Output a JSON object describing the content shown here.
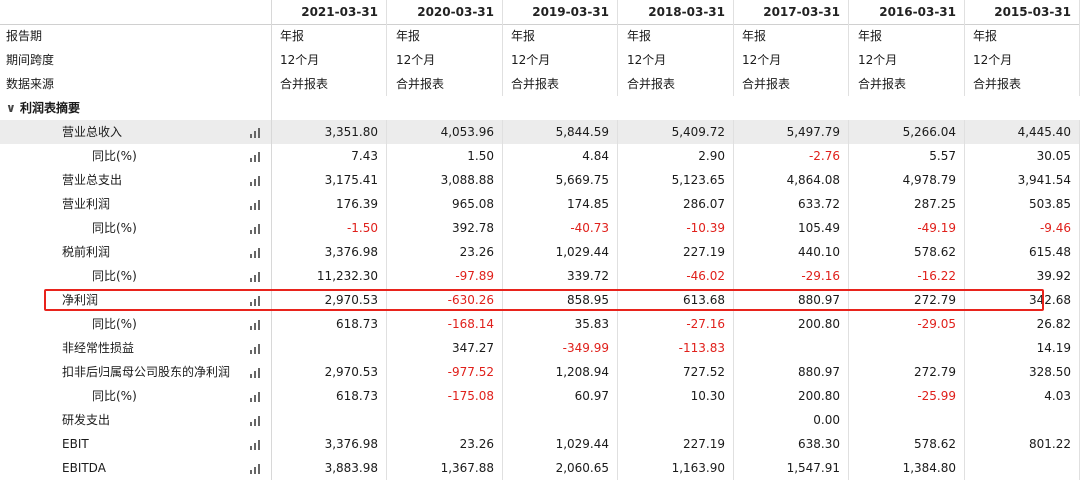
{
  "columns": [
    "2021-03-31",
    "2020-03-31",
    "2019-03-31",
    "2018-03-31",
    "2017-03-31",
    "2016-03-31",
    "2015-03-31"
  ],
  "meta_rows": [
    {
      "label": "报告期",
      "values": [
        "年报",
        "年报",
        "年报",
        "年报",
        "年报",
        "年报",
        "年报"
      ]
    },
    {
      "label": "期间跨度",
      "values": [
        "12个月",
        "12个月",
        "12个月",
        "12个月",
        "12个月",
        "12个月",
        "12个月"
      ]
    },
    {
      "label": "数据来源",
      "values": [
        "合并报表",
        "合并报表",
        "合并报表",
        "合并报表",
        "合并报表",
        "合并报表",
        "合并报表"
      ]
    }
  ],
  "section": {
    "label": "利润表摘要"
  },
  "rows": [
    {
      "label": "营业总收入",
      "indent": 1,
      "values": [
        "3,351.80",
        "4,053.96",
        "5,844.59",
        "5,409.72",
        "5,497.79",
        "5,266.04",
        "4,445.40"
      ]
    },
    {
      "label": "同比(%)",
      "indent": 2,
      "values": [
        "7.43",
        "1.50",
        "4.84",
        "2.90",
        "-2.76",
        "5.57",
        "30.05"
      ]
    },
    {
      "label": "营业总支出",
      "indent": 1,
      "values": [
        "3,175.41",
        "3,088.88",
        "5,669.75",
        "5,123.65",
        "4,864.08",
        "4,978.79",
        "3,941.54"
      ]
    },
    {
      "label": "营业利润",
      "indent": 1,
      "values": [
        "176.39",
        "965.08",
        "174.85",
        "286.07",
        "633.72",
        "287.25",
        "503.85"
      ]
    },
    {
      "label": "同比(%)",
      "indent": 2,
      "values": [
        "-1.50",
        "392.78",
        "-40.73",
        "-10.39",
        "105.49",
        "-49.19",
        "-9.46"
      ]
    },
    {
      "label": "税前利润",
      "indent": 1,
      "values": [
        "3,376.98",
        "23.26",
        "1,029.44",
        "227.19",
        "440.10",
        "578.62",
        "615.48"
      ]
    },
    {
      "label": "同比(%)",
      "indent": 2,
      "values": [
        "11,232.30",
        "-97.89",
        "339.72",
        "-46.02",
        "-29.16",
        "-16.22",
        "39.92"
      ]
    },
    {
      "label": "净利润",
      "indent": 1,
      "values": [
        "2,970.53",
        "-630.26",
        "858.95",
        "613.68",
        "880.97",
        "272.79",
        "342.68"
      ]
    },
    {
      "label": "同比(%)",
      "indent": 2,
      "values": [
        "618.73",
        "-168.14",
        "35.83",
        "-27.16",
        "200.80",
        "-29.05",
        "26.82"
      ]
    },
    {
      "label": "非经常性损益",
      "indent": 1,
      "values": [
        "",
        "347.27",
        "-349.99",
        "-113.83",
        "",
        "",
        "14.19"
      ]
    },
    {
      "label": "扣非后归属母公司股东的净利润",
      "indent": 1,
      "values": [
        "2,970.53",
        "-977.52",
        "1,208.94",
        "727.52",
        "880.97",
        "272.79",
        "328.50"
      ]
    },
    {
      "label": "同比(%)",
      "indent": 2,
      "values": [
        "618.73",
        "-175.08",
        "60.97",
        "10.30",
        "200.80",
        "-25.99",
        "4.03"
      ]
    },
    {
      "label": "研发支出",
      "indent": 1,
      "values": [
        "",
        "",
        "",
        "",
        "0.00",
        "",
        ""
      ]
    },
    {
      "label": "EBIT",
      "indent": 1,
      "values": [
        "3,376.98",
        "23.26",
        "1,029.44",
        "227.19",
        "638.30",
        "578.62",
        "801.22"
      ]
    },
    {
      "label": "EBITDA",
      "indent": 1,
      "values": [
        "3,883.98",
        "1,367.88",
        "2,060.65",
        "1,163.90",
        "1,547.91",
        "1,384.80",
        ""
      ]
    }
  ],
  "highlight_row_label": "净利润",
  "colors": {
    "negative": "#e0201b",
    "highlight_border": "#e8231c",
    "grey_band": "#ececec"
  },
  "icons": {
    "row_chart": "bar-chart-icon",
    "section_toggle": "chevron-down-icon"
  }
}
